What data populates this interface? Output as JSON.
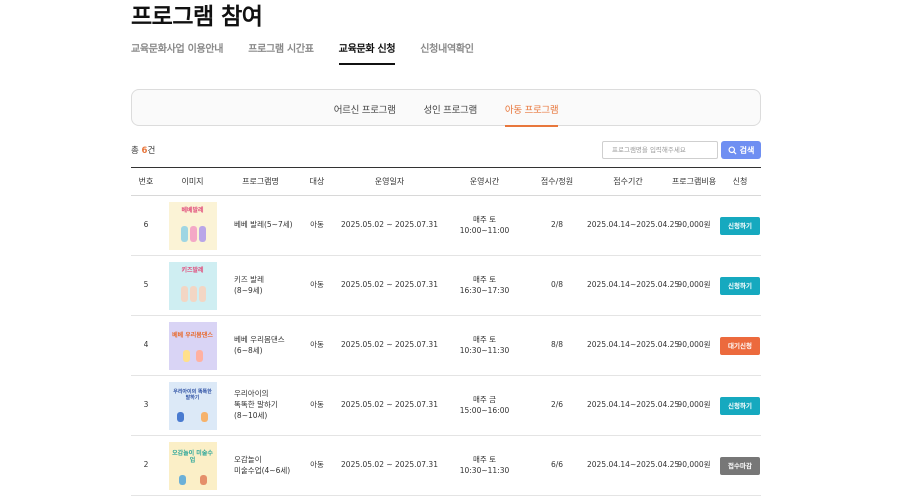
{
  "page": {
    "title": "프로그램 참여"
  },
  "main_tabs": [
    {
      "label": "교육문화사업 이용안내"
    },
    {
      "label": "프로그램 시간표"
    },
    {
      "label": "교육문화 신청"
    },
    {
      "label": "신청내역확인"
    }
  ],
  "sub_tabs": [
    {
      "label": "어르신 프로그램"
    },
    {
      "label": "성인 프로그램"
    },
    {
      "label": "아동 프로그램"
    }
  ],
  "total": {
    "prefix": "총",
    "count": "6",
    "suffix": "건"
  },
  "search": {
    "placeholder": "프로그램명을 입력해주세요",
    "button_label": "검색"
  },
  "table": {
    "headers": [
      "번호",
      "이미지",
      "프로그램명",
      "대상",
      "운영일자",
      "운영시간",
      "접수/정원",
      "접수기간",
      "프로그램비용",
      "신청"
    ],
    "rows": [
      {
        "no": "6",
        "thumb_text": "베베발레",
        "name_line1": "베베 발레(5~7세)",
        "name_line2": "",
        "target": "아동",
        "dates": "2025.05.02 ~ 2025.07.31",
        "time_line1": "매주 토",
        "time_line2": "10:00~11:00",
        "enroll": "2/8",
        "period": "2025.04.14~2025.04.25",
        "fee": "90,000원",
        "status": "신청하기",
        "status_type": "open",
        "thumb_bg": "#fbf3d6",
        "thumb_color": "#e04b7a"
      },
      {
        "no": "5",
        "thumb_text": "키즈발레",
        "name_line1": "키즈 발레",
        "name_line2": "(8~9세)",
        "target": "아동",
        "dates": "2025.05.02 ~ 2025.07.31",
        "time_line1": "매주 토",
        "time_line2": "16:30~17:30",
        "enroll": "0/8",
        "period": "2025.04.14~2025.04.25",
        "fee": "90,000원",
        "status": "신청하기",
        "status_type": "open",
        "thumb_bg": "#cfeef2",
        "thumb_color": "#e04b7a"
      },
      {
        "no": "4",
        "thumb_text": "베베 우리몸댄스",
        "name_line1": "베베 우리몸댄스",
        "name_line2": "(6~8세)",
        "target": "아동",
        "dates": "2025.05.02 ~ 2025.07.31",
        "time_line1": "매주 토",
        "time_line2": "10:30~11:30",
        "enroll": "8/8",
        "period": "2025.04.14~2025.04.25",
        "fee": "90,000원",
        "status": "대기신청",
        "status_type": "wait",
        "thumb_bg": "#d9d4f5",
        "thumb_color": "#e86a2c"
      },
      {
        "no": "3",
        "thumb_text": "우리아이의 똑똑한 말하기",
        "name_line1": "우리아이의",
        "name_line2": "똑똑한 말하기",
        "name_line3": "(8~10세)",
        "target": "아동",
        "dates": "2025.05.02 ~ 2025.07.31",
        "time_line1": "매주 금",
        "time_line2": "15:00~16:00",
        "enroll": "2/6",
        "period": "2025.04.14~2025.04.25",
        "fee": "90,000원",
        "status": "신청하기",
        "status_type": "open",
        "thumb_bg": "#dce9f7",
        "thumb_color": "#2c4fa3"
      },
      {
        "no": "2",
        "thumb_text": "오감놀이 미술수업",
        "name_line1": "오감놀이",
        "name_line2": "미술수업(4~6세)",
        "target": "아동",
        "dates": "2025.05.02 ~ 2025.07.31",
        "time_line1": "매주 토",
        "time_line2": "10:30~11:30",
        "enroll": "6/6",
        "period": "2025.04.14~2025.04.25",
        "fee": "90,000원",
        "status": "접수마감",
        "status_type": "closed",
        "thumb_bg": "#fbefc7",
        "thumb_color": "#2aa69a"
      }
    ]
  },
  "colors": {
    "accent": "#e8773c",
    "search_button": "#6f8ff2",
    "status_open": "#16a9bf",
    "status_wait": "#ec6a3d",
    "status_closed": "#777777"
  }
}
